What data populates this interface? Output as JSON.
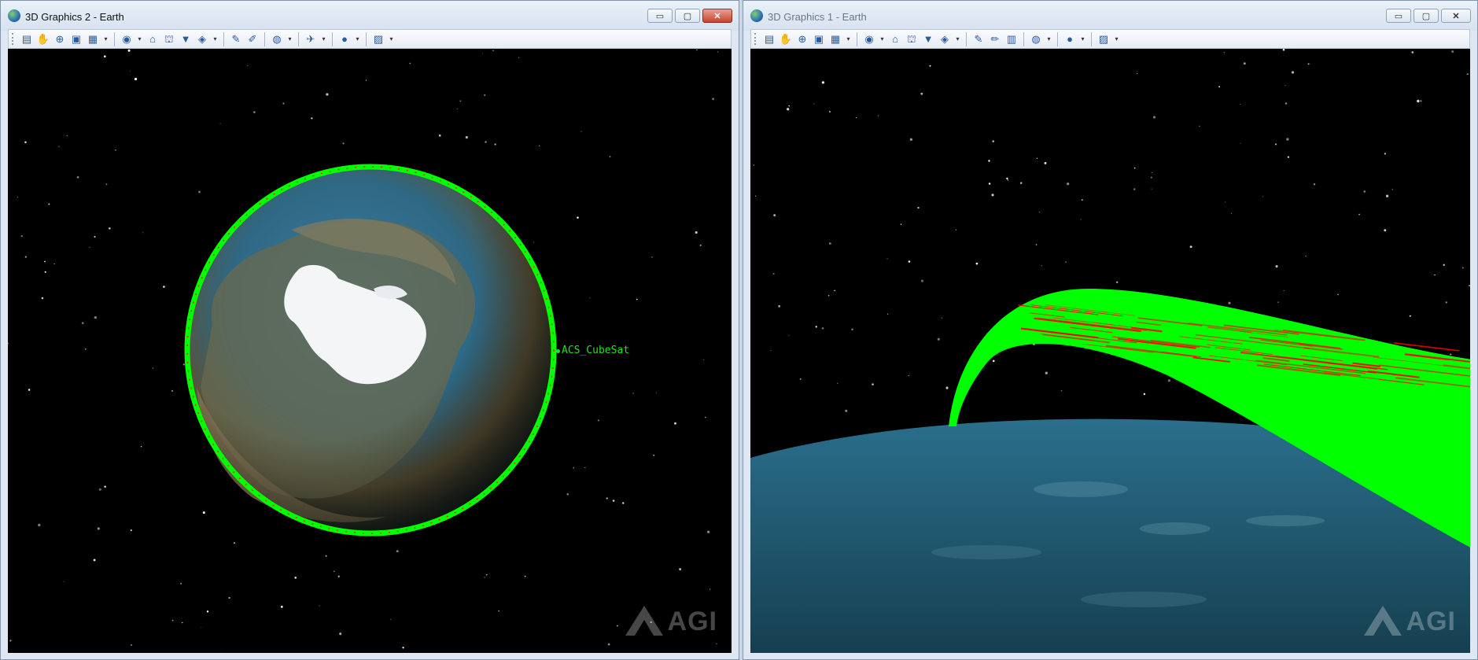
{
  "windows": [
    {
      "title": "3D Graphics 2 - Earth",
      "active": true,
      "satellite_label": "ACS_CubeSat",
      "watermark": "AGI"
    },
    {
      "title": "3D Graphics 1 - Earth",
      "active": false,
      "watermark": "AGI"
    }
  ],
  "caption_buttons": {
    "minimize": "▭",
    "maximize": "▢",
    "close": "✕"
  },
  "toolbar_icons": {
    "left": [
      "properties-icon",
      "pan-icon",
      "zoom-icon",
      "view-from-icon",
      "snapshot-icon",
      "drop",
      "sep",
      "eye-icon",
      "drop",
      "home-icon",
      "view-home-icon",
      "view-down-icon",
      "view-options-icon",
      "drop",
      "sep",
      "measure-icon",
      "tool-icon",
      "sep",
      "globe-icon",
      "drop",
      "sep",
      "satellite-icon",
      "drop",
      "sep",
      "earth-icon",
      "drop",
      "sep",
      "image-icon",
      "drop"
    ],
    "right": [
      "properties-icon",
      "pan-icon",
      "zoom-icon",
      "view-from-icon",
      "snapshot-icon",
      "drop",
      "sep",
      "eye-icon",
      "drop",
      "home-icon",
      "view-home-icon",
      "view-down-icon",
      "view-options-icon",
      "drop",
      "sep",
      "pen-icon",
      "marker-icon",
      "ruler-icon",
      "sep",
      "globe-icon",
      "drop",
      "sep",
      "earth-icon",
      "drop",
      "sep",
      "image-icon",
      "drop"
    ]
  },
  "colors": {
    "orbit_green": "#00ff00",
    "orbit_red": "#ff0000",
    "space": "#000000",
    "ocean": "#2a6f8c"
  }
}
